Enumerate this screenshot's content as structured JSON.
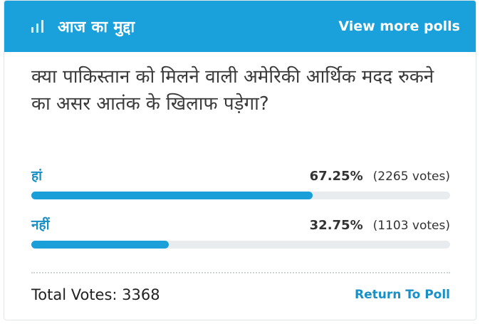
{
  "header": {
    "title": "आज का मुद्दा",
    "more_link": "View more polls",
    "icon": "bar-chart-icon"
  },
  "question": "क्या पाकिस्तान को मिलने वाली अमेरिकी आर्थिक मदद रुकने का असर आतंक के खिलाफ पड़ेगा?",
  "options": [
    {
      "label": "हां",
      "percent": "67.25%",
      "votes": "(2265 votes)",
      "fraction": 0.6725
    },
    {
      "label": "नहीं",
      "percent": "32.75%",
      "votes": "(1103 votes)",
      "fraction": 0.3275
    }
  ],
  "footer": {
    "total": "Total Votes: 3368",
    "return_link": "Return To Poll"
  },
  "colors": {
    "header_bg": "#1aa1db",
    "bar_fill": "#1a9fd8",
    "bar_track": "#e9ecef",
    "link": "#1a8fc6"
  }
}
